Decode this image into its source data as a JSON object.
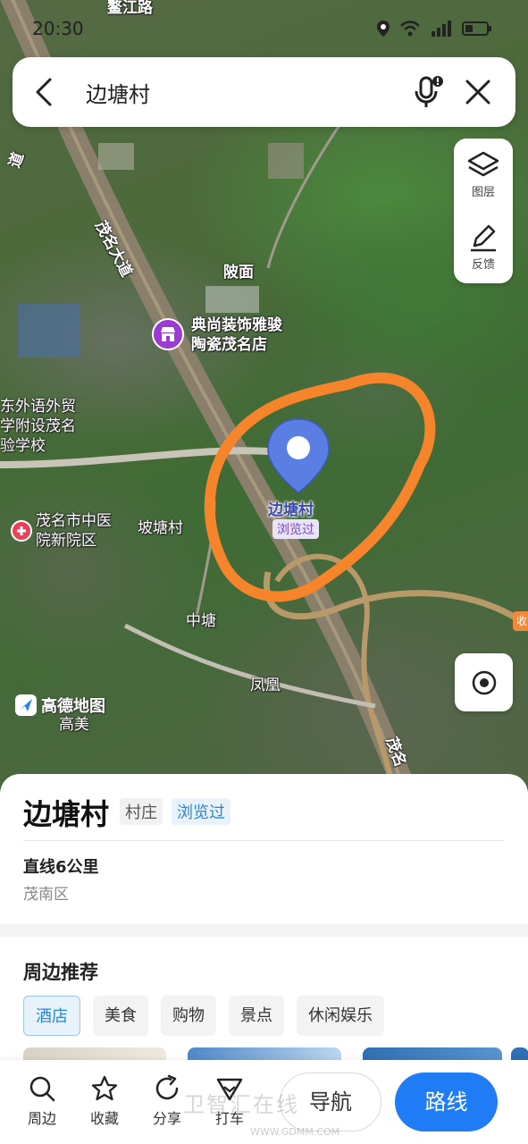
{
  "status_bar": {
    "time": "20:30"
  },
  "search": {
    "query": "边塘村"
  },
  "map_tools": {
    "layers_label": "图层",
    "feedback_label": "反馈"
  },
  "map_labels": {
    "road_top": "鳌江路",
    "road_left_top": "道",
    "road_maoming": "茂名大道",
    "place_lingmian": "陂面",
    "poi_store": "典尚装饰雅骏\n陶瓷茂名店",
    "school": "东外语外贸\n学附设茂名\n验学校",
    "hospital": "茂名市中医\n院新院区",
    "place_potang": "坡塘村",
    "place_zhongtang": "中塘",
    "place_fenghuang": "凤凰",
    "place_gaomei": "高美",
    "road_bottom": "茂名",
    "edge_tag": "收"
  },
  "pin": {
    "name": "边塘村",
    "tag": "浏览过"
  },
  "brand": {
    "name": "高德地图"
  },
  "place": {
    "name": "边塘村",
    "type": "村庄",
    "viewed": "浏览过",
    "distance": "直线6公里",
    "district": "茂南区"
  },
  "nearby": {
    "title": "周边推荐",
    "categories": [
      "酒店",
      "美食",
      "购物",
      "景点",
      "休闲娱乐"
    ],
    "active_index": 0
  },
  "actions": {
    "nearby": "周边",
    "favorite": "收藏",
    "share": "分享",
    "taxi": "打车",
    "navigate": "导航",
    "route": "路线"
  },
  "watermark": {
    "text": "卫智汇在线",
    "url": "WWW.GDMM.COM"
  },
  "colors": {
    "accent": "#1f7cf5",
    "highlight_circle": "#f5842b",
    "pin": "#5b7ee5"
  }
}
